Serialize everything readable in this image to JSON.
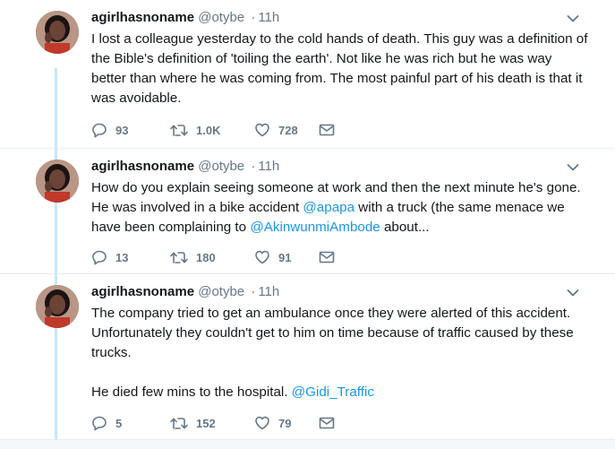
{
  "colors": {
    "link": "#1b95e0",
    "muted": "#657786",
    "thread": "#c4e7fa"
  },
  "icons": {
    "reply": "reply-icon",
    "retweet": "retweet-icon",
    "like": "heart-icon",
    "dm": "envelope-icon",
    "menu": "chevron-down-icon"
  },
  "tweets": [
    {
      "name": "agirlhasnoname",
      "handle": "@otybe",
      "dot": "·",
      "time": "11h",
      "text": "I lost a colleague yesterday to the cold hands of death. This guy was a definition of the Bible's definition of 'toiling the earth'. Not like he was rich but he was way better than where he was coming from. The most painful part of his death is that it was avoidable.",
      "replies": "93",
      "retweets": "1.0K",
      "likes": "728"
    },
    {
      "name": "agirlhasnoname",
      "handle": "@otybe",
      "dot": "·",
      "time": "11h",
      "text_parts": [
        "How do you explain seeing someone at work and then the next minute he's gone. He was involved in a bike accident ",
        "@apapa",
        " with a truck (the same menace we have been complaining to ",
        "@AkinwunmiAmbode",
        " about..."
      ],
      "replies": "13",
      "retweets": "180",
      "likes": "91"
    },
    {
      "name": "agirlhasnoname",
      "handle": "@otybe",
      "dot": "·",
      "time": "11h",
      "text_parts": [
        "The company tried to get an ambulance once they were alerted of this accident. Unfortunately they couldn't get to him on time because of traffic caused by these trucks.\n\nHe died few mins to the hospital. ",
        "@Gidi_Traffic"
      ],
      "replies": "5",
      "retweets": "152",
      "likes": "79"
    }
  ]
}
